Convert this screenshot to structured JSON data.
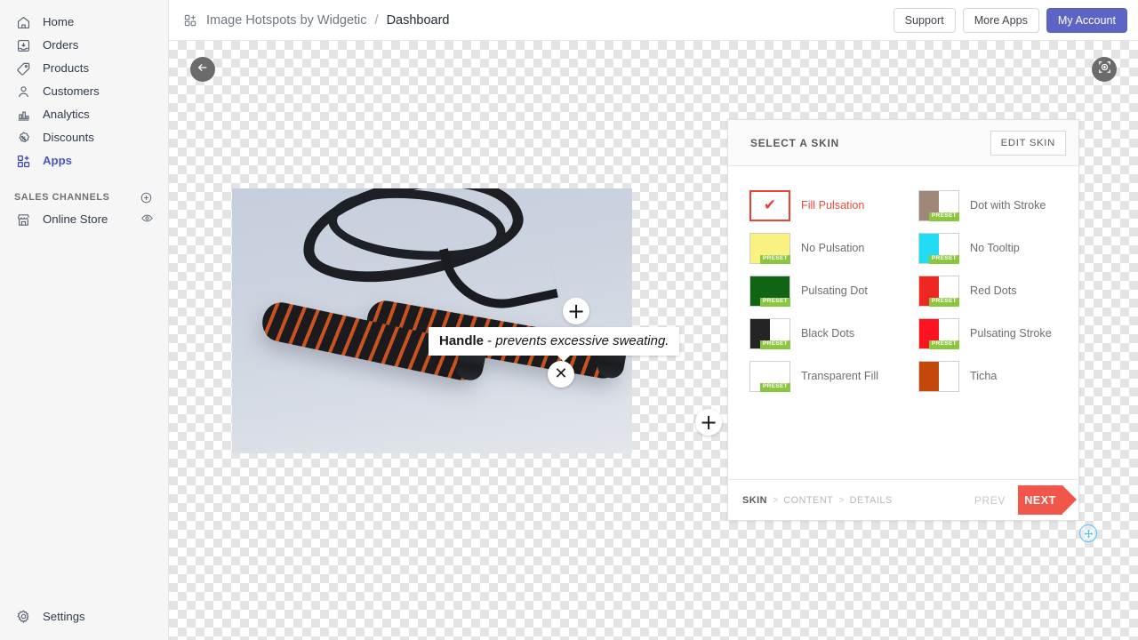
{
  "sidebar": {
    "items": [
      {
        "label": "Home",
        "icon": "home-icon",
        "active": false
      },
      {
        "label": "Orders",
        "icon": "orders-icon",
        "active": false
      },
      {
        "label": "Products",
        "icon": "products-tag-icon",
        "active": false
      },
      {
        "label": "Customers",
        "icon": "customers-icon",
        "active": false
      },
      {
        "label": "Analytics",
        "icon": "analytics-bars-icon",
        "active": false
      },
      {
        "label": "Discounts",
        "icon": "discounts-icon",
        "active": false
      },
      {
        "label": "Apps",
        "icon": "apps-grid-icon",
        "active": true
      }
    ],
    "section": {
      "title": "SALES CHANNELS",
      "add_icon": "plus-circle-icon"
    },
    "channels": [
      {
        "label": "Online Store",
        "icon": "storefront-icon",
        "trailing_icon": "eye-icon"
      }
    ],
    "settings": {
      "label": "Settings",
      "icon": "gear-icon"
    },
    "active_color": "#4b56c0"
  },
  "topbar": {
    "app_icon": "apps-grid-plus-icon",
    "app_name": "Image Hotspots by Widgetic",
    "separator": "/",
    "page": "Dashboard",
    "buttons": [
      {
        "label": "Support",
        "primary": false
      },
      {
        "label": "More Apps",
        "primary": false
      },
      {
        "label": "My Account",
        "primary": true
      }
    ],
    "primary_color": "#5c64c4"
  },
  "canvas": {
    "back_button_icon": "arrow-left-icon",
    "add_hotspot_button_icon": "frame-plus-icon",
    "move_handle_icon": "move-plus-circle-icon",
    "hotspots": [
      {
        "name": "hotspot-top",
        "glyph": "+"
      },
      {
        "name": "hotspot-close",
        "glyph": "✕"
      },
      {
        "name": "hotspot-bottom",
        "glyph": "+"
      }
    ],
    "tooltip": {
      "title": "Handle",
      "dash": " - ",
      "text": "prevents excessive sweating."
    }
  },
  "panel": {
    "title": "SELECT A SKIN",
    "edit_button": "EDIT SKIN",
    "skins": [
      {
        "label": "Fill Pulsation",
        "color": "#ffffff",
        "split": false,
        "preset": false,
        "selected": true,
        "check": "✔"
      },
      {
        "label": "Dot with Stroke",
        "color": "#9e8778",
        "split": true,
        "preset": true,
        "selected": false
      },
      {
        "label": "No Pulsation",
        "color": "#f9f281",
        "split": false,
        "preset": true,
        "selected": false
      },
      {
        "label": "No Tooltip",
        "color": "#22dbf5",
        "split": true,
        "preset": true,
        "selected": false
      },
      {
        "label": "Pulsating Dot",
        "color": "#0f6514",
        "split": false,
        "preset": true,
        "selected": false
      },
      {
        "label": "Red Dots",
        "color": "#ee2722",
        "split": true,
        "preset": true,
        "selected": false
      },
      {
        "label": "Black Dots",
        "color": "#242424",
        "split": true,
        "preset": true,
        "selected": false
      },
      {
        "label": "Pulsating Stroke",
        "color": "#fb1420",
        "split": true,
        "preset": true,
        "selected": false
      },
      {
        "label": "Transparent Fill",
        "color": "#ffffff",
        "split": false,
        "preset": true,
        "selected": false
      },
      {
        "label": "Ticha",
        "color": "#c4470b",
        "split": true,
        "preset": false,
        "selected": false
      }
    ],
    "preset_badge": "PRESET",
    "preset_badge_color": "#8cc63e",
    "selected_color": "#ef3e33",
    "footer": {
      "steps": [
        {
          "label": "SKIN",
          "active": true
        },
        {
          "label": "CONTENT",
          "active": false
        },
        {
          "label": "DETAILS",
          "active": false
        }
      ],
      "step_separator": ">",
      "prev_label": "PREV",
      "next_label": "NEXT",
      "next_color": "#f1564a"
    }
  }
}
